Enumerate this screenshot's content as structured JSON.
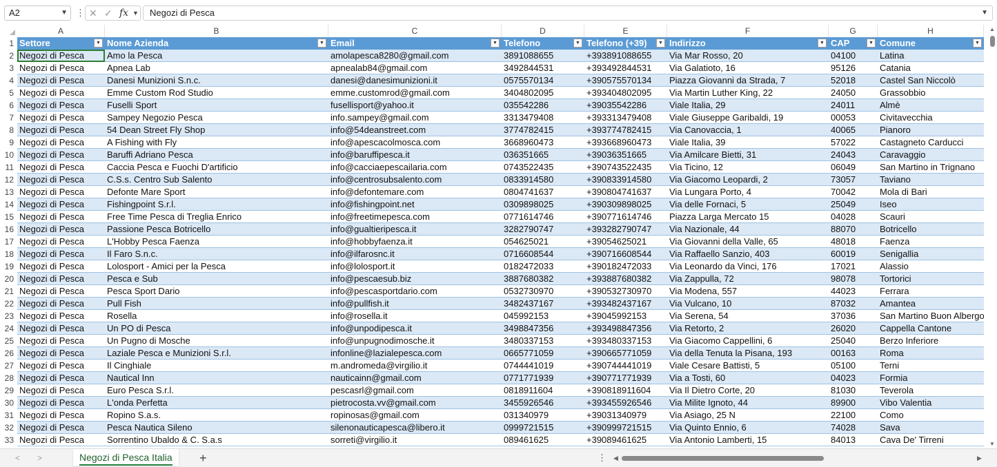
{
  "name_box": "A2",
  "formula_value": "Negozi di Pesca",
  "formula_tools": {
    "cancel": "✕",
    "enter": "✓",
    "fx": "fx"
  },
  "column_letters": [
    "A",
    "B",
    "C",
    "D",
    "E",
    "F",
    "G",
    "H"
  ],
  "headers": [
    "Settore",
    "Nome Azienda",
    "Email",
    "Telefono",
    "Telefono (+39)",
    "Indirizzo",
    "CAP",
    "Comune"
  ],
  "rows": [
    [
      "Negozi di Pesca",
      "Amo la Pesca",
      "amolapesca8280@gmail.com",
      "3891088655",
      "+393891088655",
      "Via Mar Rosso, 20",
      "04100",
      "Latina"
    ],
    [
      "Negozi di Pesca",
      "Apnea Lab",
      "apnealab84@gmail.com",
      "3492844531",
      "+393492844531",
      "Via Galatioto, 16",
      "95126",
      "Catania"
    ],
    [
      "Negozi di Pesca",
      "Danesi Munizioni S.n.c.",
      "danesi@danesimunizioni.it",
      "0575570134",
      "+390575570134",
      "Piazza Giovanni da Strada, 7",
      "52018",
      "Castel San Niccolò"
    ],
    [
      "Negozi di Pesca",
      "Emme Custom Rod Studio",
      "emme.customrod@gmail.com",
      "3404802095",
      "+393404802095",
      "Via Martin Luther King, 22",
      "24050",
      "Grassobbio"
    ],
    [
      "Negozi di Pesca",
      "Fuselli Sport",
      "fusellisport@yahoo.it",
      "035542286",
      "+39035542286",
      "Viale Italia, 29",
      "24011",
      "Almè"
    ],
    [
      "Negozi di Pesca",
      "Sampey Negozio Pesca",
      "info.sampey@gmail.com",
      "3313479408",
      "+393313479408",
      "Viale Giuseppe Garibaldi, 19",
      "00053",
      "Civitavecchia"
    ],
    [
      "Negozi di Pesca",
      "54 Dean Street Fly Shop",
      "info@54deanstreet.com",
      "3774782415",
      "+393774782415",
      "Via Canovaccia, 1",
      "40065",
      "Pianoro"
    ],
    [
      "Negozi di Pesca",
      "A Fishing with Fly",
      "info@apescacolmosca.com",
      "3668960473",
      "+393668960473",
      "Viale Italia, 39",
      "57022",
      "Castagneto Carducci"
    ],
    [
      "Negozi di Pesca",
      "Baruffi Adriano Pesca",
      "info@baruffipesca.it",
      "036351665",
      "+39036351665",
      "Via Amilcare Bietti, 31",
      "24043",
      "Caravaggio"
    ],
    [
      "Negozi di Pesca",
      "Caccia Pesca e Fuochi D'artificio",
      "info@cacciaepescailaria.com",
      "0743522435",
      "+390743522435",
      "Via Ticino, 12",
      "06049",
      "San Martino in Trignano"
    ],
    [
      "Negozi di Pesca",
      "C.S.s. Centro Sub Salento",
      "info@centrosubsalento.com",
      "0833914580",
      "+390833914580",
      "Via Giacomo Leopardi, 2",
      "73057",
      "Taviano"
    ],
    [
      "Negozi di Pesca",
      "Defonte Mare Sport",
      "info@defontemare.com",
      "0804741637",
      "+390804741637",
      "Via Lungara Porto, 4",
      "70042",
      "Mola di Bari"
    ],
    [
      "Negozi di Pesca",
      "Fishingpoint S.r.l.",
      "info@fishingpoint.net",
      "0309898025",
      "+390309898025",
      "Via delle Fornaci, 5",
      "25049",
      "Iseo"
    ],
    [
      "Negozi di Pesca",
      "Free Time Pesca di Treglia Enrico",
      "info@freetimepesca.com",
      "0771614746",
      "+390771614746",
      "Piazza Larga Mercato 15",
      "04028",
      "Scauri"
    ],
    [
      "Negozi di Pesca",
      "Passione Pesca Botricello",
      "info@gualtieripesca.it",
      "3282790747",
      "+393282790747",
      "Via Nazionale, 44",
      "88070",
      "Botricello"
    ],
    [
      "Negozi di Pesca",
      "L'Hobby Pesca Faenza",
      "info@hobbyfaenza.it",
      "054625021",
      "+39054625021",
      "Via Giovanni della Valle, 65",
      "48018",
      "Faenza"
    ],
    [
      "Negozi di Pesca",
      "Il Faro S.n.c.",
      "info@ilfarosnc.it",
      "0716608544",
      "+390716608544",
      "Via Raffaello Sanzio, 403",
      "60019",
      "Senigallia"
    ],
    [
      "Negozi di Pesca",
      "Lolosport - Amici per la Pesca",
      "info@lolosport.it",
      "0182472033",
      "+390182472033",
      "Via Leonardo da Vinci, 176",
      "17021",
      "Alassio"
    ],
    [
      "Negozi di Pesca",
      "Pesca e Sub",
      "info@pescaesub.biz",
      "3887680382",
      "+393887680382",
      "Via Zappulla, 72",
      "98078",
      "Tortorici"
    ],
    [
      "Negozi di Pesca",
      "Pesca Sport Dario",
      "info@pescasportdario.com",
      "0532730970",
      "+390532730970",
      "Via Modena, 557",
      "44023",
      "Ferrara"
    ],
    [
      "Negozi di Pesca",
      "Pull Fish",
      "info@pullfish.it",
      "3482437167",
      "+393482437167",
      "Via Vulcano, 10",
      "87032",
      "Amantea"
    ],
    [
      "Negozi di Pesca",
      "Rosella",
      "info@rosella.it",
      "045992153",
      "+39045992153",
      "Via Serena, 54",
      "37036",
      "San Martino Buon Albergo"
    ],
    [
      "Negozi di Pesca",
      "Un PO di Pesca",
      "info@unpodipesca.it",
      "3498847356",
      "+393498847356",
      "Via Retorto, 2",
      "26020",
      "Cappella Cantone"
    ],
    [
      "Negozi di Pesca",
      "Un Pugno di Mosche",
      "info@unpugnodimosche.it",
      "3480337153",
      "+393480337153",
      "Via Giacomo Cappellini, 6",
      "25040",
      "Berzo Inferiore"
    ],
    [
      "Negozi di Pesca",
      "Laziale Pesca e Munizioni S.r.l.",
      "infonline@lazialepesca.com",
      "0665771059",
      "+390665771059",
      "Via della Tenuta la Pisana, 193",
      "00163",
      "Roma"
    ],
    [
      "Negozi di Pesca",
      "Il Cinghiale",
      "m.andromeda@virgilio.it",
      "0744441019",
      "+390744441019",
      "Viale Cesare Battisti, 5",
      "05100",
      "Terni"
    ],
    [
      "Negozi di Pesca",
      "Nautical Inn",
      "nauticainn@gmail.com",
      "0771771939",
      "+390771771939",
      "Via a Tosti, 60",
      "04023",
      "Formia"
    ],
    [
      "Negozi di Pesca",
      "Euro Pesca S.r.l.",
      "pescasrl@gmail.com",
      "0818911604",
      "+390818911604",
      "Via Il Dietro Corte, 20",
      "81030",
      "Teverola"
    ],
    [
      "Negozi di Pesca",
      "L'onda Perfetta",
      "pietrocosta.vv@gmail.com",
      "3455926546",
      "+393455926546",
      "Via Milite Ignoto, 44",
      "89900",
      "Vibo Valentia"
    ],
    [
      "Negozi di Pesca",
      "Ropino S.a.s.",
      "ropinosas@gmail.com",
      "031340979",
      "+39031340979",
      "Via Asiago, 25 N",
      "22100",
      "Como"
    ],
    [
      "Negozi di Pesca",
      "Pesca Nautica Sileno",
      "silenonauticapesca@libero.it",
      "0999721515",
      "+390999721515",
      "Via Quinto Ennio, 6",
      "74028",
      "Sava"
    ],
    [
      "Negozi di Pesca",
      "Sorrentino Ubaldo & C. S.a.s",
      "sorreti@virgilio.it",
      "089461625",
      "+39089461625",
      "Via Antonio Lamberti, 15",
      "84013",
      "Cava De' Tirreni"
    ]
  ],
  "sheet_tab": "Negozi di Pesca Italia",
  "colors": {
    "header_fill": "#5b9bd5",
    "band_fill": "#dbe8f5",
    "selection": "#2e7d32"
  },
  "icons": [
    "chevron-down-icon",
    "cancel-icon",
    "enter-icon",
    "fx-icon",
    "filter-dropdown-icon",
    "add-sheet-icon",
    "scroll-left-icon",
    "scroll-right-icon"
  ]
}
